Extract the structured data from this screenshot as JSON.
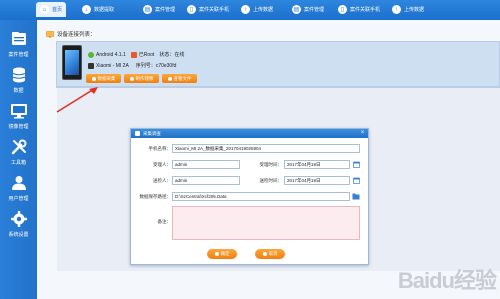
{
  "topbar": {
    "tabs": [
      {
        "label": "首页",
        "active": true
      },
      {
        "label": "数据提取",
        "active": false
      },
      {
        "label": "案件管理",
        "active": false
      },
      {
        "label": "案件关联手机",
        "active": false
      },
      {
        "label": "上传数据",
        "active": false
      },
      {
        "label": "案件管理",
        "active": false
      },
      {
        "label": "案件关联手机",
        "active": false
      },
      {
        "label": "上传数据",
        "active": false
      }
    ]
  },
  "sidebar": {
    "items": [
      {
        "label": "案件管理",
        "icon": "folder-icon"
      },
      {
        "label": "数据",
        "icon": "database-icon"
      },
      {
        "label": "镜像管理",
        "icon": "monitor-icon"
      },
      {
        "label": "工具箱",
        "icon": "tools-icon"
      },
      {
        "label": "用户管理",
        "icon": "user-icon"
      },
      {
        "label": "系统设置",
        "icon": "gear-icon"
      }
    ]
  },
  "main": {
    "section_title": "设备连接列表："
  },
  "device": {
    "android": "Android 4.1.1",
    "root": "已Root",
    "status_label": "状态：",
    "status_value": "在线",
    "model": "Xiaomi - MI 2A",
    "serial_label": "序列号：",
    "serial_value": "c70e30fd",
    "buttons": [
      "数据采集",
      "制作镜像",
      "查看文件"
    ]
  },
  "dialog": {
    "title": "采集调查",
    "phone_name_label": "手机名称：",
    "phone_name_value": "Xiaomi_MI 2A_数据采集_20170419025904",
    "receiver_label": "受理人：",
    "receiver_value": "admin",
    "receive_time_label": "受理时间：",
    "receive_time_value": "2017年04月19日",
    "inspector_label": "送检人：",
    "inspector_value": "admin",
    "inspect_time_label": "送检时间：",
    "inspect_time_value": "2017年04月19日",
    "save_path_label": "数据保存路径：",
    "save_path_value": "D:\\SzCentral\\Xcf205.Data",
    "note_label": "备注：",
    "note_value": "",
    "ok_label": "确定",
    "cancel_label": "取消"
  },
  "watermark": {
    "text": "Baidu经验"
  },
  "colors": {
    "primary": "#2272c9",
    "accent": "#ef7f10",
    "panel": "#cfdff2"
  }
}
